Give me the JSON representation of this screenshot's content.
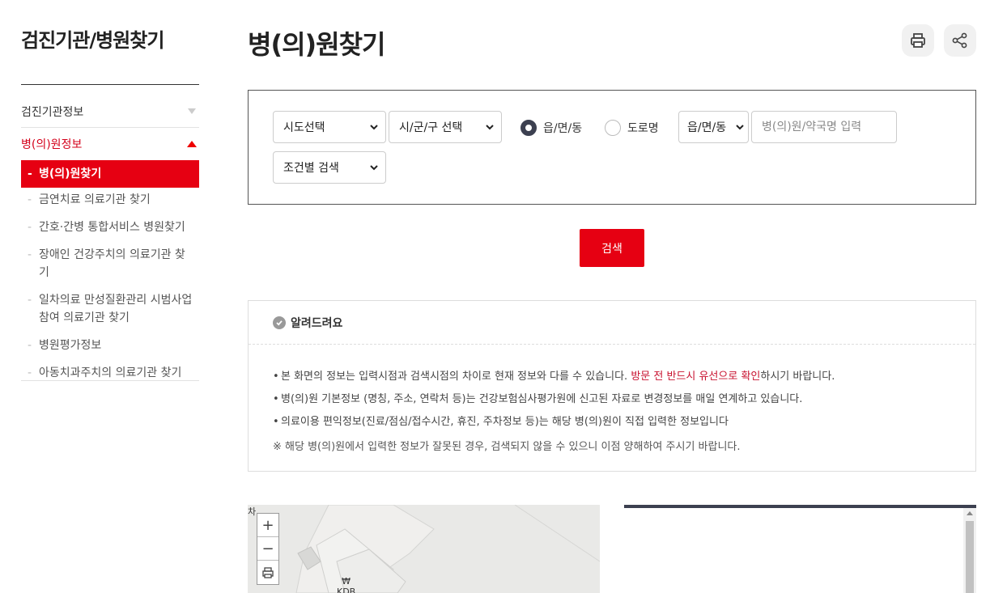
{
  "sidebar": {
    "title": "검진기관/병원찾기",
    "menu": [
      {
        "label": "검진기관정보"
      },
      {
        "label": "병(의)원정보"
      }
    ],
    "sub_items": [
      {
        "label": "병(의)원찾기"
      },
      {
        "label": "금연치료 의료기관 찾기"
      },
      {
        "label": "간호·간병 통합서비스 병원찾기"
      },
      {
        "label": "장애인 건강주치의 의료기관 찾기"
      },
      {
        "label": "일차의료 만성질환관리 시범사업 참여 의료기관 찾기"
      },
      {
        "label": "병원평가정보"
      },
      {
        "label": "아동치과주치의 의료기관 찾기"
      }
    ]
  },
  "main": {
    "title": "병(의)원찾기",
    "search": {
      "sido_select": "시도선택",
      "sigungu_select": "시/군/구 선택",
      "radio_dong": "읍/면/동",
      "radio_road": "도로명",
      "dong_select": "읍/면/동",
      "name_placeholder": "병(의)원/약국명 입력",
      "condition_select": "조건별 검색",
      "button": "검색"
    },
    "notice": {
      "title": "알려드려요",
      "line1_pre": "본 화면의 정보는 입력시점과 검색시점의 차이로 현재 정보와 다를 수 있습니다. ",
      "line1_red": "방문 전 반드시 유선으로 확인",
      "line1_post": "하시기 바랍니다.",
      "line2": "병(의)원 기본정보 (명칭, 주소, 연락처 등)는 건강보험심사평가원에 신고된 자료로 변경정보를 매일 연계하고 있습니다.",
      "line3": "의료이용 편익정보(진료/점심/접수시간, 휴진, 주차정보 등)는 해당 병(의)원이 직접 입력한 정보입니다",
      "note": "※ 해당 병(의)원에서 입력한 정보가 잘못된 경우, 검색되지 않을 수 있으니 이점 양해하여 주시기 바랍니다."
    },
    "map": {
      "zoom_in": "+",
      "zoom_out": "−",
      "label_kdb": "KDB",
      "label_corner": "차"
    }
  },
  "colors": {
    "accent": "#e60012",
    "dark": "#3c4050"
  }
}
